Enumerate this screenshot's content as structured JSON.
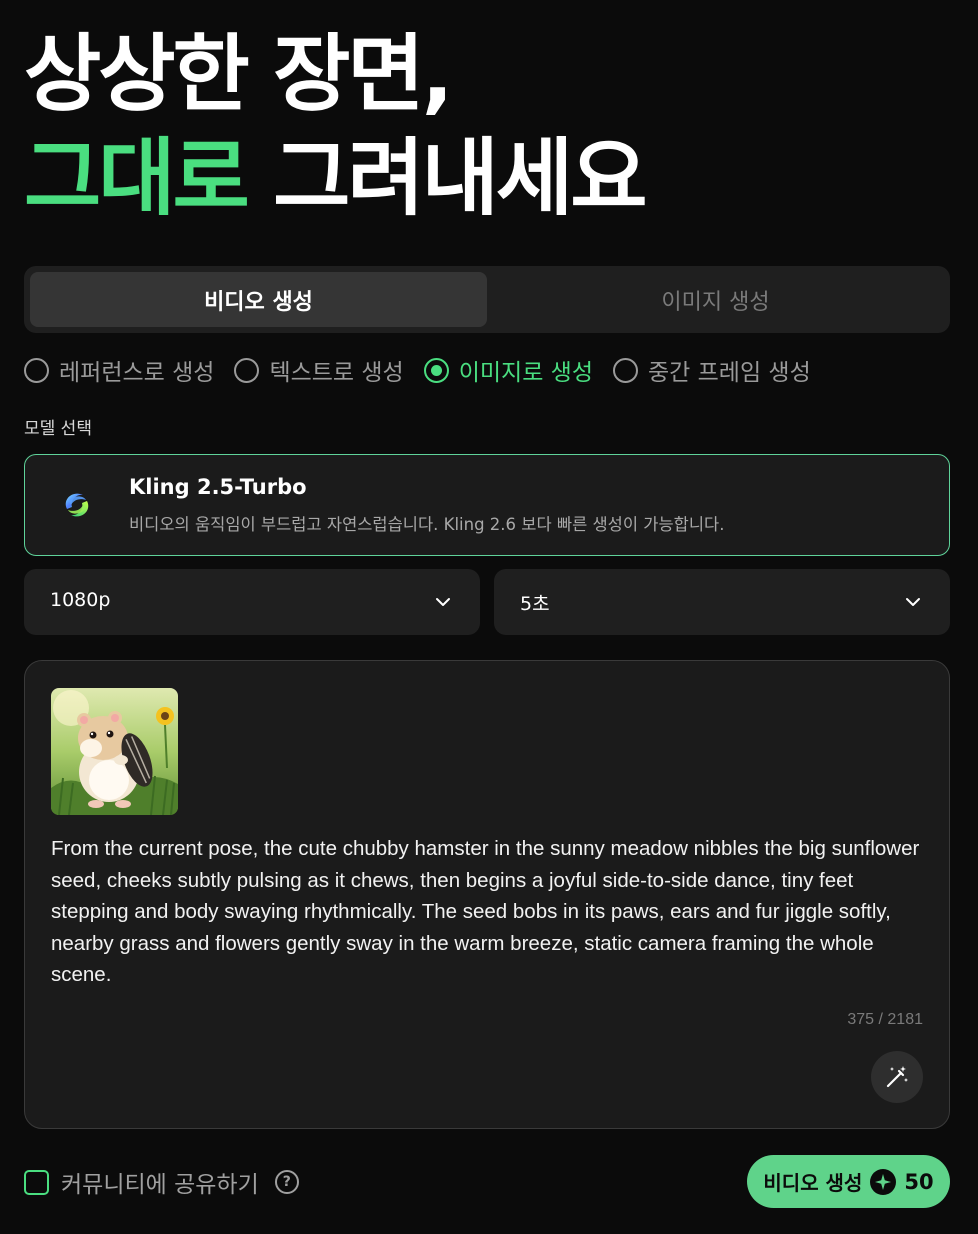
{
  "hero": {
    "line1": "상상한 장면,",
    "line2_accent": "그대로",
    "line2_rest": " 그려내세요"
  },
  "tabs": [
    {
      "label": "비디오 생성",
      "active": true
    },
    {
      "label": "이미지 생성",
      "active": false
    }
  ],
  "modes": [
    {
      "label": "레퍼런스로 생성",
      "selected": false
    },
    {
      "label": "텍스트로 생성",
      "selected": false
    },
    {
      "label": "이미지로 생성",
      "selected": true
    },
    {
      "label": "중간 프레임 생성",
      "selected": false
    }
  ],
  "model": {
    "section_label": "모델 선택",
    "name": "Kling 2.5-Turbo",
    "description": "비디오의 움직임이 부드럽고 자연스럽습니다. Kling 2.6 보다 빠른 생성이 가능합니다."
  },
  "resolution": {
    "value": "1080p"
  },
  "duration": {
    "value": "5초"
  },
  "prompt": {
    "text": "From the current pose, the cute chubby hamster in the sunny meadow nibbles the big sunflower seed, cheeks subtly pulsing as it chews, then begins a joyful side-to-side dance, tiny feet stepping and body swaying rhythmically. The seed bobs in its paws, ears and fur jiggle softly, nearby grass and flowers gently sway in the warm breeze, static camera framing the whole scene.",
    "counter": "375 / 2181"
  },
  "share": {
    "label": "커뮤니티에 공유하기",
    "checked": false
  },
  "generate": {
    "label": "비디오 생성",
    "cost": "50"
  },
  "colors": {
    "accent": "#4ade80",
    "button": "#5fd38a",
    "background": "#0b0b0b"
  }
}
